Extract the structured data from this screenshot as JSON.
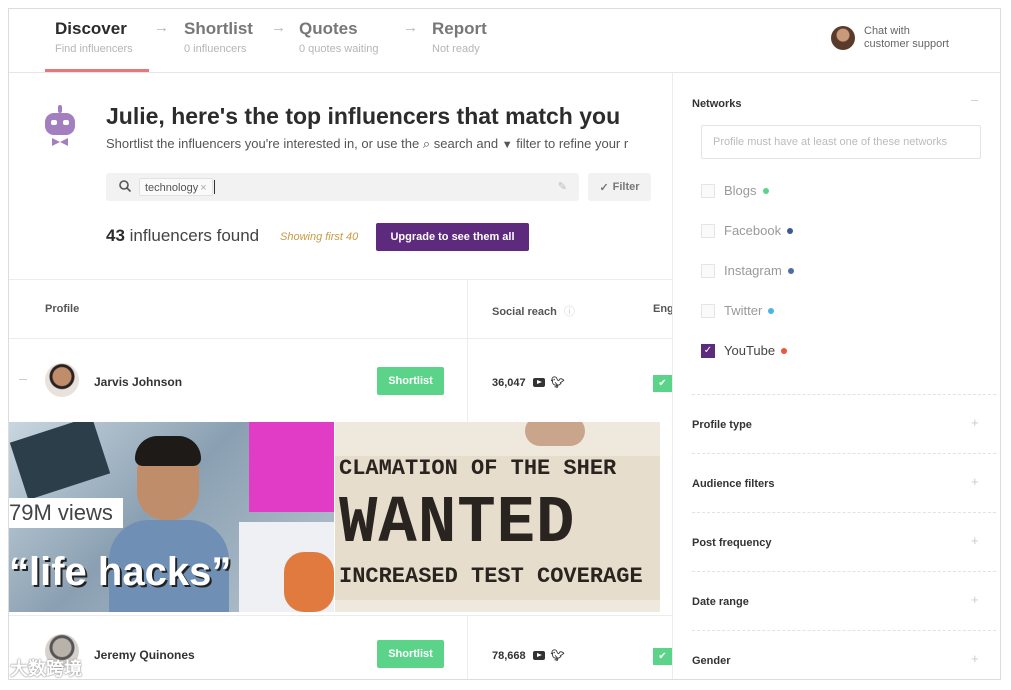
{
  "steps": [
    {
      "title": "Discover",
      "subtitle": "Find influencers"
    },
    {
      "title": "Shortlist",
      "subtitle": "0 influencers"
    },
    {
      "title": "Quotes",
      "subtitle": "0 quotes waiting"
    },
    {
      "title": "Report",
      "subtitle": "Not ready"
    }
  ],
  "support": {
    "line1": "Chat with",
    "line2": "customer support"
  },
  "headline": "Julie, here's the top influencers that match you",
  "subline": {
    "part1": "Shortlist the influencers you're interested in, or use the",
    "search_word": "search and",
    "filter_word": "filter to refine your r"
  },
  "search": {
    "tag": "technology",
    "tag_remove": "×"
  },
  "filter_button": "Filter",
  "results": {
    "count": "43",
    "label": "influencers found",
    "showing": "Showing first 40",
    "upgrade": "Upgrade to see them all"
  },
  "table": {
    "col_profile": "Profile",
    "col_reach": "Social reach",
    "col_eng": "Eng"
  },
  "rows": [
    {
      "name": "Jarvis Johnson",
      "shortlist": "Shortlist",
      "reach": "36,047"
    },
    {
      "name": "Jeremy Quinones",
      "shortlist": "Shortlist",
      "reach": "78,668"
    }
  ],
  "videos": {
    "views": "79M views",
    "hacks": "“life hacks”",
    "wanted_l1": "CLAMATION OF THE SHER",
    "wanted_l2": "WANTED",
    "wanted_l3": "INCREASED TEST COVERAGE"
  },
  "panel": {
    "networks_title": "Networks",
    "networks_placeholder": "Profile must have at least one of these networks",
    "networks": [
      {
        "label": "Blogs",
        "color": "#5bd48a",
        "checked": false
      },
      {
        "label": "Facebook",
        "color": "#3b5998",
        "checked": false
      },
      {
        "label": "Instagram",
        "color": "#4a6fa5",
        "checked": false
      },
      {
        "label": "Twitter",
        "color": "#4cb3e6",
        "checked": false
      },
      {
        "label": "YouTube",
        "color": "#e8563f",
        "checked": true
      }
    ],
    "sections": [
      "Profile type",
      "Audience filters",
      "Post frequency",
      "Date range",
      "Gender"
    ]
  },
  "watermark": "大数跨境"
}
